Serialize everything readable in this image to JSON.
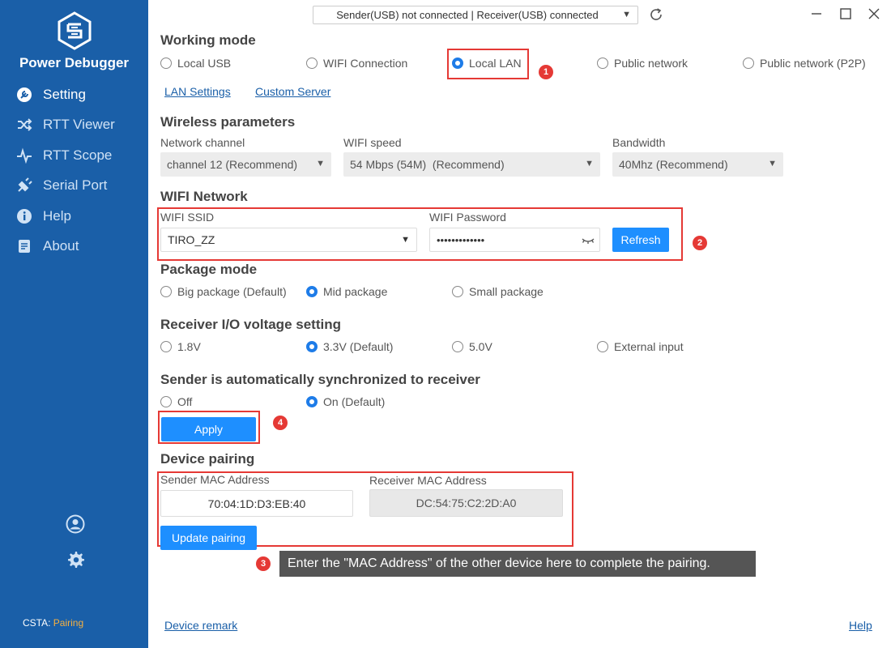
{
  "sidebar": {
    "brand": "Power Debugger",
    "items": [
      {
        "label": "Setting"
      },
      {
        "label": "RTT Viewer"
      },
      {
        "label": "RTT Scope"
      },
      {
        "label": "Serial Port"
      },
      {
        "label": "Help"
      },
      {
        "label": "About"
      }
    ],
    "status_label": "CSTA:",
    "status_value": "Pairing"
  },
  "topbar": {
    "connection_status": "Sender(USB) not connected | Receiver(USB) connected"
  },
  "working_mode": {
    "title": "Working mode",
    "options": [
      "Local USB",
      "WIFI Connection",
      "Local LAN",
      "Public network",
      "Public network (P2P)"
    ],
    "selected": "Local LAN",
    "lan_settings_link": "LAN Settings",
    "custom_server_link": "Custom Server"
  },
  "wireless": {
    "title": "Wireless parameters",
    "channel_label": "Network channel",
    "channel_value": "channel 12 (Recommend)",
    "speed_label": "WIFI speed",
    "speed_value": "54 Mbps (54M)  (Recommend)",
    "bandwidth_label": "Bandwidth",
    "bandwidth_value": "40Mhz (Recommend)"
  },
  "wifi_network": {
    "title": "WIFI Network",
    "ssid_label": "WIFI SSID",
    "ssid_value": "TIRO_ZZ",
    "password_label": "WIFI Password",
    "password_value": "•••••••••••••",
    "refresh_label": "Refresh"
  },
  "package_mode": {
    "title": "Package mode",
    "options": [
      "Big package (Default)",
      "Mid package",
      "Small package"
    ],
    "selected": "Mid package"
  },
  "voltage": {
    "title": "Receiver I/O voltage setting",
    "options": [
      "1.8V",
      "3.3V (Default)",
      "5.0V",
      "External input"
    ],
    "selected": "3.3V (Default)"
  },
  "sync": {
    "title": "Sender is automatically synchronized to receiver",
    "options": [
      "Off",
      "On (Default)"
    ],
    "selected": "On (Default)",
    "apply_label": "Apply"
  },
  "pairing": {
    "title": "Device pairing",
    "sender_label": "Sender MAC Address",
    "sender_value": "70:04:1D:D3:EB:40",
    "receiver_label": "Receiver MAC Address",
    "receiver_value": "DC:54:75:C2:2D:A0",
    "update_label": "Update pairing"
  },
  "annotations": {
    "badges": [
      "1",
      "2",
      "3",
      "4"
    ],
    "tooltip": "Enter the \"MAC Address\" of the other device here to complete the pairing."
  },
  "footer": {
    "device_remark": "Device remark",
    "help": "Help"
  },
  "colors": {
    "sidebar_bg": "#1a5fa8",
    "accent": "#1e8fff",
    "annotation_red": "#e53935",
    "status_value": "#f5b041"
  }
}
